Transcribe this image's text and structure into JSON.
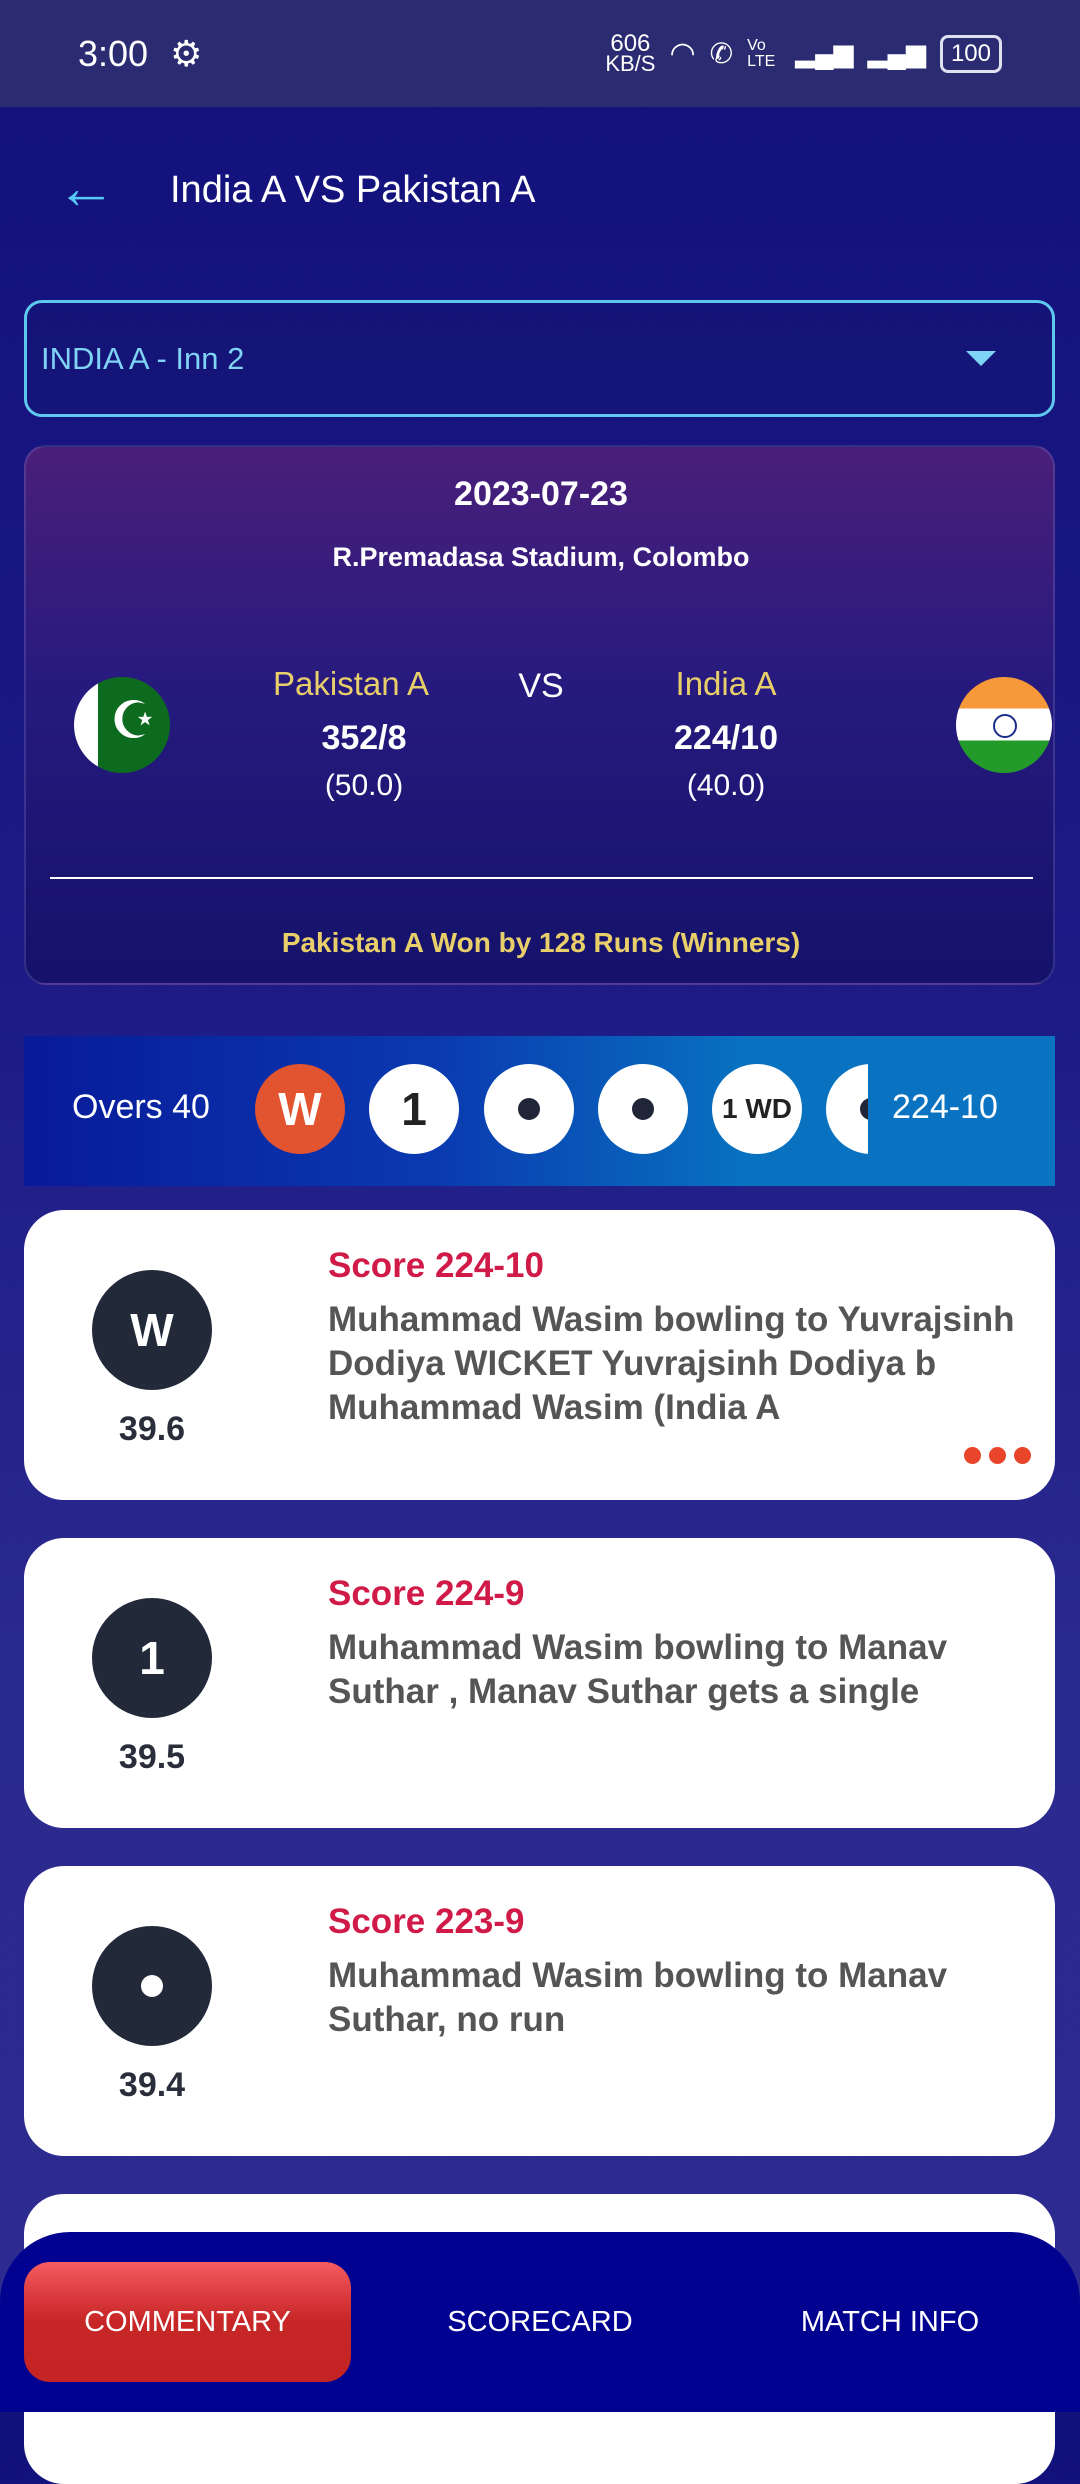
{
  "status_bar": {
    "time": "3:00",
    "net_speed": "606",
    "net_unit": "KB/S",
    "battery": "100",
    "volte": "Vo LTE"
  },
  "header": {
    "title": "India A VS Pakistan A"
  },
  "innings_select": {
    "value": "INDIA A - Inn 2"
  },
  "match": {
    "date": "2023-07-23",
    "venue": "R.Premadasa Stadium, Colombo",
    "vs": "VS",
    "team1": {
      "name": "Pakistan A",
      "score": "352/8",
      "overs": "(50.0)",
      "flag": "pakistan-flag"
    },
    "team2": {
      "name": "India A",
      "score": "224/10",
      "overs": "(40.0)",
      "flag": "india-flag"
    },
    "result": "Pakistan A Won by 128 Runs (Winners)"
  },
  "over_strip": {
    "label": "Overs 40",
    "balls": [
      "W",
      "1",
      "•",
      "•",
      "1 WD",
      "•"
    ],
    "score": "224-10",
    "wicket_color": "#e2532f"
  },
  "commentary": [
    {
      "ball": "W",
      "over": "39.6",
      "score": "Score 224-10",
      "text": "Muhammad Wasim bowling to Yuvrajsinh Dodiya WICKET Yuvrajsinh Dodiya b Muhammad Wasim (India A",
      "more": true
    },
    {
      "ball": "1",
      "over": "39.5",
      "score": "Score 224-9",
      "text": "Muhammad Wasim bowling to Manav Suthar , Manav Suthar gets a single"
    },
    {
      "ball": "•",
      "over": "39.4",
      "score": "Score 223-9",
      "text": "Muhammad Wasim bowling to Manav Suthar, no run"
    }
  ],
  "bottom_nav": {
    "tabs": [
      "COMMENTARY",
      "SCORECARD",
      "MATCH INFO"
    ],
    "active": "COMMENTARY"
  }
}
